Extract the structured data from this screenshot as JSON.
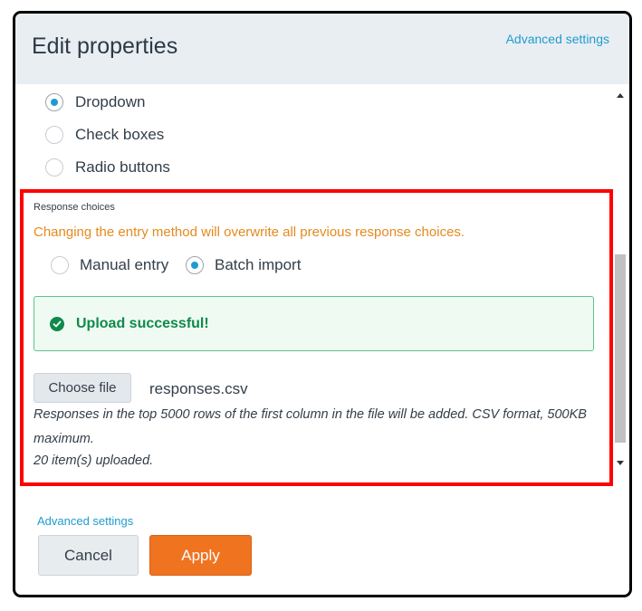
{
  "dialog": {
    "title": "Edit properties",
    "advanced_settings_top": "Advanced settings"
  },
  "entry_type": {
    "options": [
      {
        "label": "Dropdown",
        "checked": true
      },
      {
        "label": "Check boxes",
        "checked": false
      },
      {
        "label": "Radio buttons",
        "checked": false
      }
    ]
  },
  "response_choices": {
    "label": "Response choices",
    "warning": "Changing the entry method will overwrite all previous response choices.",
    "methods": [
      {
        "label": "Manual entry",
        "checked": false
      },
      {
        "label": "Batch import",
        "checked": true
      }
    ],
    "success_message": "Upload successful!",
    "choose_file_label": "Choose file",
    "file_name": "responses.csv",
    "help_text": "Responses in the top 5000 rows of the first column in the file will be added. CSV format, 500KB maximum.",
    "uploaded_text": "20 item(s) uploaded."
  },
  "footer": {
    "advanced_settings": "Advanced settings",
    "cancel_label": "Cancel",
    "apply_label": "Apply"
  },
  "colors": {
    "accent_blue": "#1f9ccf",
    "apply_orange": "#f07320",
    "warning_orange": "#e58a1d",
    "success_green": "#0f8a4a",
    "highlight_red": "#ff0000"
  }
}
